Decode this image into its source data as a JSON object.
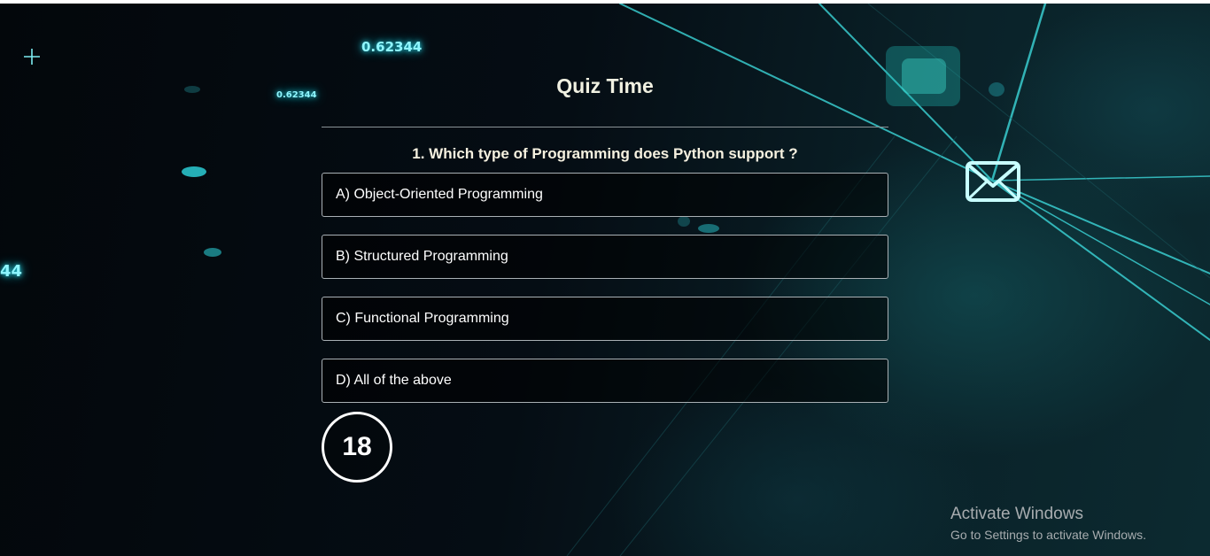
{
  "quiz": {
    "title": "Quiz Time",
    "question": "1. Which type of Programming does Python support ?",
    "options": [
      "A) Object-Oriented Programming",
      "B) Structured Programming",
      "C) Functional Programming",
      "D) All of the above"
    ],
    "timer": "18"
  },
  "background": {
    "numbers": [
      "0.62344",
      "0.62344",
      "44"
    ],
    "icons": [
      "plus-icon",
      "mail-icon"
    ],
    "accent_color": "#2fe0e6"
  },
  "watermark": {
    "title": "Activate Windows",
    "subtitle": "Go to Settings to activate Windows."
  }
}
